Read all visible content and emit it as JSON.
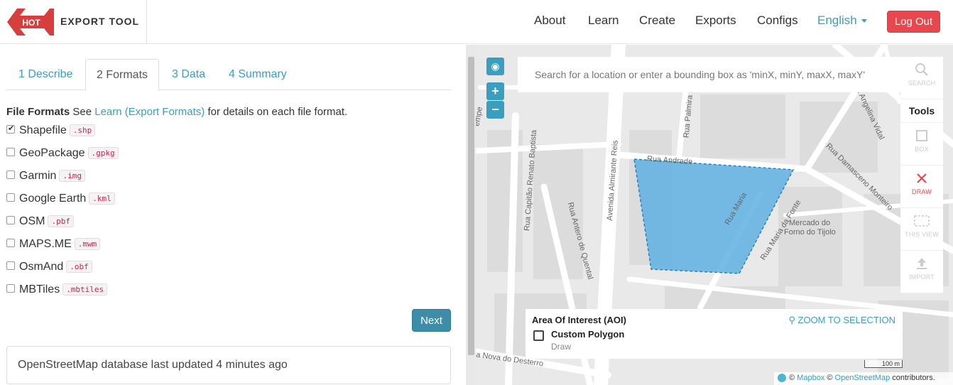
{
  "navbar": {
    "logo_text": "HOT",
    "brand": "EXPORT TOOL",
    "links": [
      "About",
      "Learn",
      "Create",
      "Exports",
      "Configs"
    ],
    "language": "English",
    "logout": "Log Out"
  },
  "tabs": [
    "1 Describe",
    "2 Formats",
    "3 Data",
    "4 Summary"
  ],
  "file_formats": {
    "heading": "File Formats",
    "see": "See",
    "link": "Learn (Export Formats)",
    "rest": "for details on each file format.",
    "items": [
      {
        "label": "Shapefile",
        "ext": ".shp",
        "checked": true
      },
      {
        "label": "GeoPackage",
        "ext": ".gpkg",
        "checked": false
      },
      {
        "label": "Garmin",
        "ext": ".img",
        "checked": false
      },
      {
        "label": "Google Earth",
        "ext": ".kml",
        "checked": false
      },
      {
        "label": "OSM",
        "ext": ".pbf",
        "checked": false
      },
      {
        "label": "MAPS.ME",
        "ext": ".mwm",
        "checked": false
      },
      {
        "label": "OsmAnd",
        "ext": ".obf",
        "checked": false
      },
      {
        "label": "MBTiles",
        "ext": ".mbtiles",
        "checked": false
      }
    ]
  },
  "next_button": "Next",
  "status": "OpenStreetMap database last updated 4 minutes ago",
  "map": {
    "search_placeholder": "Search for a location or enter a bounding box as 'minX, minY, maxX, maxY'",
    "zoom_in": "+",
    "zoom_out": "−",
    "tools_title": "Tools",
    "tools": [
      {
        "label": "SEARCH",
        "icon": "search-icon"
      },
      {
        "label": "BOX",
        "icon": "square-icon"
      },
      {
        "label": "DRAW",
        "icon": "close-icon"
      },
      {
        "label": "THIS VIEW",
        "icon": "view-icon"
      },
      {
        "label": "IMPORT",
        "icon": "upload-icon"
      }
    ],
    "aoi": {
      "title": "Area Of Interest (AOI)",
      "zoom": "ZOOM TO SELECTION",
      "name": "Custom Polygon",
      "sub": "Draw"
    },
    "scale": "100 m",
    "attribution": {
      "mapbox": "Mapbox",
      "osm": "OpenStreetMap",
      "rest": "contributors."
    },
    "street_labels": [
      "Rua Andrade",
      "Rua Palmira",
      "Rua Angelina Vidal",
      "Rua Damasceno Monteiro",
      "Avenida Almirante Reis",
      "Rua Capitão Renato Baptista",
      "Rua Antero de Quental",
      "Rua Maria",
      "Rua Maria da Fonte",
      "Mercado do",
      "Forno do Tijolo",
      "a Nova do Desterro",
      "empe"
    ],
    "colors": {
      "aoi_fill": "#5fb0e3",
      "aoi_stroke": "#2a7fbf",
      "accent": "#3a9ec1"
    }
  }
}
